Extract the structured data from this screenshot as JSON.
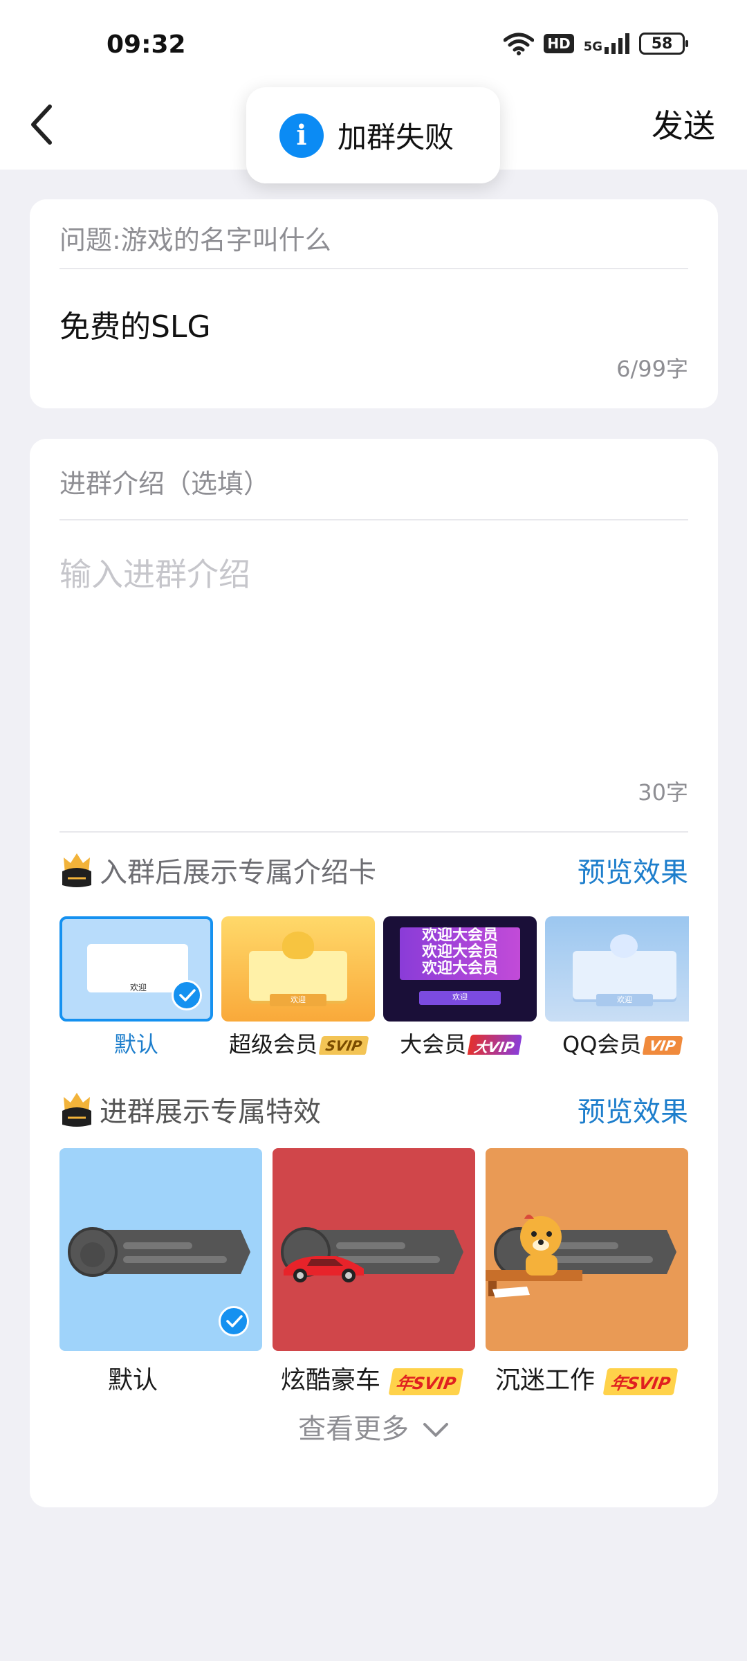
{
  "status_bar": {
    "time": "09:32",
    "hd": "HD",
    "network": "5G",
    "battery": "58"
  },
  "nav": {
    "send_label": "发送"
  },
  "toast": {
    "text": "加群失败"
  },
  "question": {
    "label": "问题:游戏的名字叫什么",
    "answer": "免费的SLG",
    "counter": "6/99字"
  },
  "intro": {
    "label": "进群介绍（选填）",
    "placeholder": "输入进群介绍",
    "counter": "30字"
  },
  "intro_card_section": {
    "title": "入群后展示专属介绍卡",
    "preview": "预览效果",
    "cards": [
      {
        "label": "默认",
        "selected": true,
        "thumb_text": "欢迎"
      },
      {
        "label": "超级会员",
        "badge": "SVIP",
        "thumb_text": "欢迎"
      },
      {
        "label": "大会员",
        "badge": "大VIP",
        "banner": "欢迎大会员",
        "thumb_text": "欢迎"
      },
      {
        "label": "QQ会员",
        "badge": "VIP",
        "thumb_text": "欢迎"
      }
    ]
  },
  "effect_section": {
    "title": "进群展示专属特效",
    "preview": "预览效果",
    "effects": [
      {
        "label": "默认",
        "selected": true,
        "bg": "#9fd3fa"
      },
      {
        "label": "炫酷豪车",
        "badge": "年SVIP",
        "bg": "#d0464a"
      },
      {
        "label": "沉迷工作",
        "badge": "年SVIP",
        "bg": "#e99a55"
      }
    ],
    "more": "查看更多"
  }
}
